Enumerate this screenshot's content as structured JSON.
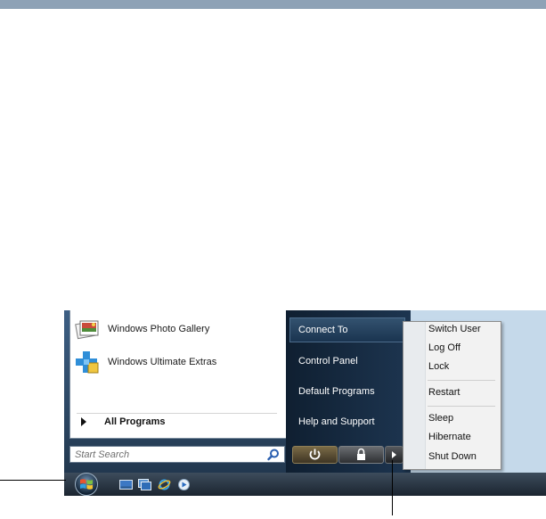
{
  "start_menu": {
    "pinned_programs": [
      {
        "label": "Windows Photo Gallery",
        "icon": "photo-gallery-icon"
      },
      {
        "label": "Windows Ultimate Extras",
        "icon": "ultimate-extras-icon"
      }
    ],
    "all_programs_label": "All Programs",
    "search": {
      "placeholder": "Start Search",
      "icon": "search-icon"
    },
    "right_items": [
      "Connect To",
      "Control Panel",
      "Default Programs",
      "Help and Support"
    ],
    "power_buttons": [
      {
        "name": "power-button",
        "icon": "power-icon"
      },
      {
        "name": "lock-button",
        "icon": "lock-icon"
      },
      {
        "name": "power-options-arrow-button",
        "icon": "right-arrow-icon"
      }
    ]
  },
  "power_submenu": {
    "groups": [
      [
        "Switch User",
        "Log Off",
        "Lock"
      ],
      [
        "Restart"
      ],
      [
        "Sleep",
        "Hibernate",
        "Shut Down"
      ]
    ]
  },
  "taskbar": {
    "start_orb_icon": "windows-start-orb-icon",
    "quick_launch_icons": [
      "show-desktop-icon",
      "switch-windows-icon",
      "internet-explorer-icon",
      "media-player-icon"
    ]
  },
  "colors": {
    "menu_dark": "#1d3550",
    "submenu_bg": "#f2f2f2",
    "taskbar": "#2a3846",
    "header_bar": "#8ea2b6"
  }
}
